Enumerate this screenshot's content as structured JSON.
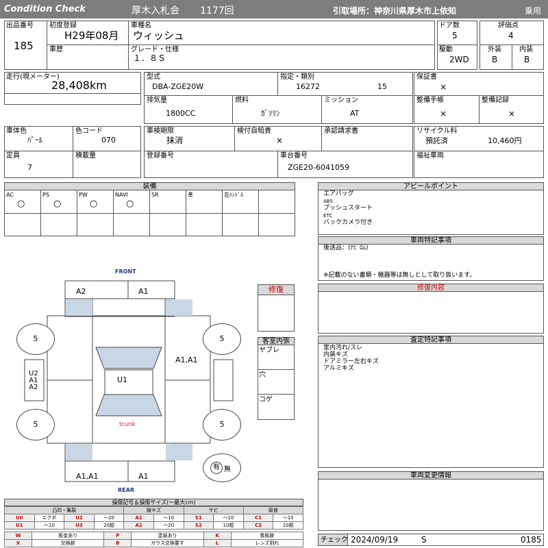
{
  "header": {
    "title_left": "Condition Check",
    "auction": "厚木入札会",
    "session": "1177回",
    "pickup": "引取場所：神奈川県厚木市上依知",
    "category": "乗用"
  },
  "basic": {
    "lot_label": "出品番号",
    "lot": "185",
    "first_reg_label": "初度登録",
    "first_reg": "H29年08月",
    "model_label": "車種名",
    "model": "ウィッシュ",
    "doors_label": "ドア数",
    "doors": "5",
    "score_label": "評価点",
    "score": "4",
    "history_label": "車歴",
    "grade_label": "グレード・仕様",
    "grade": "１．８Ｓ",
    "drive_label": "駆動",
    "drive": "2WD",
    "ext_label": "外装",
    "ext": "B",
    "int_label": "内装",
    "int": "B"
  },
  "specs": {
    "mileage_label": "走行(現メーター)",
    "mileage": "28,408km",
    "type_label": "型式",
    "type": "DBA-ZGE20W",
    "designation_label": "指定・類別",
    "designation": "16272",
    "classification": "15",
    "warranty_label": "保証書",
    "warranty": "×",
    "displacement_label": "排気量",
    "displacement": "1800CC",
    "fuel_label": "燃料",
    "fuel": "ｶﾞｿﾘﾝ",
    "mission_label": "ミッション",
    "mission": "AT",
    "maintenance_label": "整備手帳",
    "maintenance": "×",
    "record_label": "整備記録",
    "record": "×",
    "color_label": "車体色",
    "color": "ﾊﾟｰﾙ",
    "color_code_label": "色コード",
    "color_code": "070",
    "inspection_label": "車検期限",
    "inspection": "抹消",
    "liability_label": "検付自賠責",
    "liability": "×",
    "approval_label": "承認請求書",
    "recycle_label": "リサイクル料",
    "recycle_status": "預託済",
    "recycle_fee": "10,460円",
    "capacity_label": "定員",
    "capacity": "7",
    "load_label": "積載量",
    "regno_label": "登録番号",
    "chassis_label": "車台番号",
    "chassis": "ZGE20-6041059",
    "welfare_label": "福祉車両"
  },
  "equipment": {
    "title": "装備",
    "items": [
      {
        "label": "AC",
        "value": "○"
      },
      {
        "label": "PS",
        "value": "○"
      },
      {
        "label": "PW",
        "value": "○"
      },
      {
        "label": "NAVI",
        "value": "○"
      },
      {
        "label": "SR",
        "value": ""
      },
      {
        "label": "革",
        "value": ""
      },
      {
        "label": "左ﾊﾝﾄﾞﾙ",
        "value": ""
      }
    ]
  },
  "appeal": {
    "title": "アピールポイント",
    "lines": [
      "エアバッグ",
      "ABS",
      "プッシュスタート",
      "ETC",
      "バックカメラ付き"
    ]
  },
  "special": {
    "title": "車両特記事項",
    "text": "後送品：(ﾅﾋﾞﾛﾑ)",
    "note": "※記載のない書類・機器等は無しとして取り扱います。"
  },
  "repair_content": {
    "title": "修復内容"
  },
  "assessment": {
    "title": "査定特記事項",
    "lines": [
      "室内汚れ/スレ",
      "内装キズ",
      "ドアミラー左右キズ",
      "アルミキズ"
    ]
  },
  "change": {
    "title": "車両変更情報"
  },
  "check": {
    "label": "チェック",
    "date": "2024/09/19",
    "grade": "S",
    "code": "0185"
  },
  "repair": {
    "title": "修復"
  },
  "interior": {
    "title": "客室内張",
    "items": [
      "ヤブレ",
      "穴",
      "コゲ"
    ]
  },
  "diagram": {
    "front": "FRONT",
    "rear": "REAR",
    "trunk": "trunk",
    "top_left": "A2",
    "top_right": "A1",
    "roof": "U1",
    "right_side": "A1,A1",
    "left_side_lines": [
      "U2",
      "A1",
      "A2"
    ],
    "bottom_left": "A1,A1",
    "bottom_right": "A1",
    "tire_fl": "5",
    "tire_fr": "5",
    "tire_rl": "5",
    "tire_rr": "5",
    "spare_yes": "有",
    "spare_no": "無"
  },
  "legend": {
    "title": "損傷記号＆損傷サイズ(〜最大cm)",
    "groups": [
      "凸凹・亀裂",
      "線キズ",
      "サビ",
      "腐食"
    ],
    "rows": [
      [
        "U0",
        "エクボ",
        "U2",
        "〜20",
        "A1",
        "〜10",
        "S1",
        "〜10",
        "C1",
        "〜10"
      ],
      [
        "U1",
        "〜10",
        "U3",
        "20超",
        "A2",
        "〜20",
        "S2",
        "10超",
        "C2",
        "10超"
      ]
    ],
    "marks": [
      [
        "W",
        "板金あり",
        "P",
        "塗装あり",
        "K",
        "看板跡"
      ],
      [
        "X",
        "交換跡",
        "B",
        "ガラス交換要す",
        "L",
        "レンズ割れ"
      ]
    ]
  }
}
